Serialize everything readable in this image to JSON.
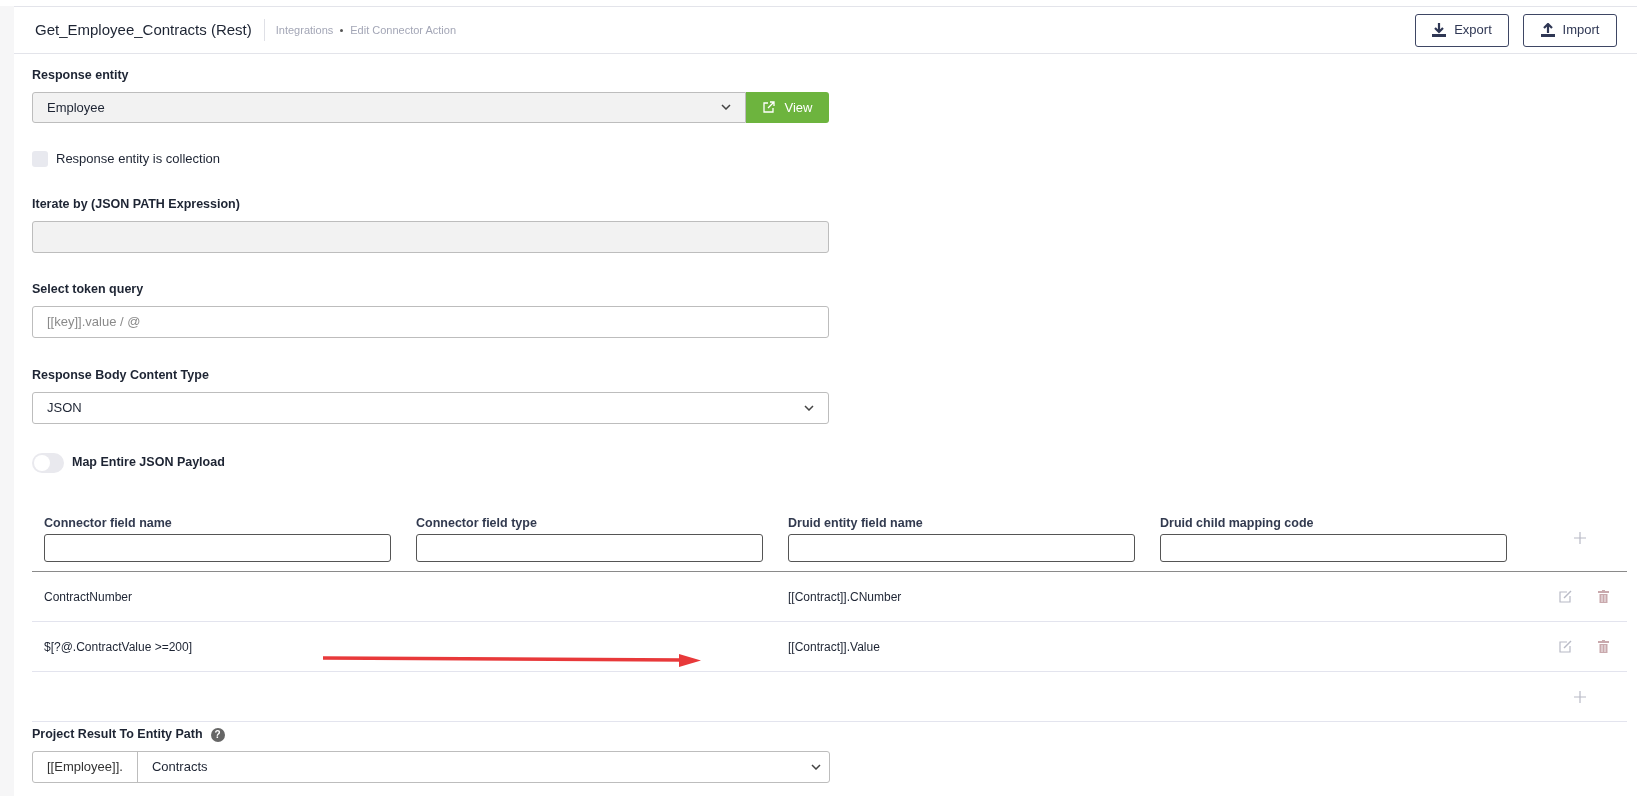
{
  "header": {
    "title": "Get_Employee_Contracts (Rest)",
    "breadcrumb": [
      "Integrations",
      "Edit Connector Action"
    ],
    "buttons": [
      {
        "kind": "export",
        "label": "Export"
      },
      {
        "kind": "import",
        "label": "Import"
      }
    ]
  },
  "response_entity": {
    "label": "Response entity",
    "value": "Employee",
    "view_button": "View"
  },
  "collection": {
    "label": "Response entity is collection",
    "checked": false
  },
  "iterate_by": {
    "label": "Iterate by (JSON PATH Expression)",
    "disabled": true
  },
  "token_query": {
    "label": "Select token query",
    "placeholder": "[[key]].value / @"
  },
  "content_type": {
    "label": "Response Body Content Type",
    "value": "JSON"
  },
  "map_payload": {
    "label": "Map Entire JSON Payload",
    "on": false
  },
  "mapping": {
    "columns": [
      "Connector field name",
      "Connector field type",
      "Druid entity field name",
      "Druid child mapping code"
    ],
    "rows": [
      {
        "cells": [
          "ContractNumber",
          "",
          "[[Contract]].CNumber",
          ""
        ]
      },
      {
        "cells": [
          "$[?@.ContractValue >=200]",
          "",
          "[[Contract]].Value",
          ""
        ]
      }
    ]
  },
  "project_result": {
    "label": "Project Result To Entity Path",
    "help": "?",
    "prefix": "[[Employee]].",
    "value": "Contracts"
  }
}
